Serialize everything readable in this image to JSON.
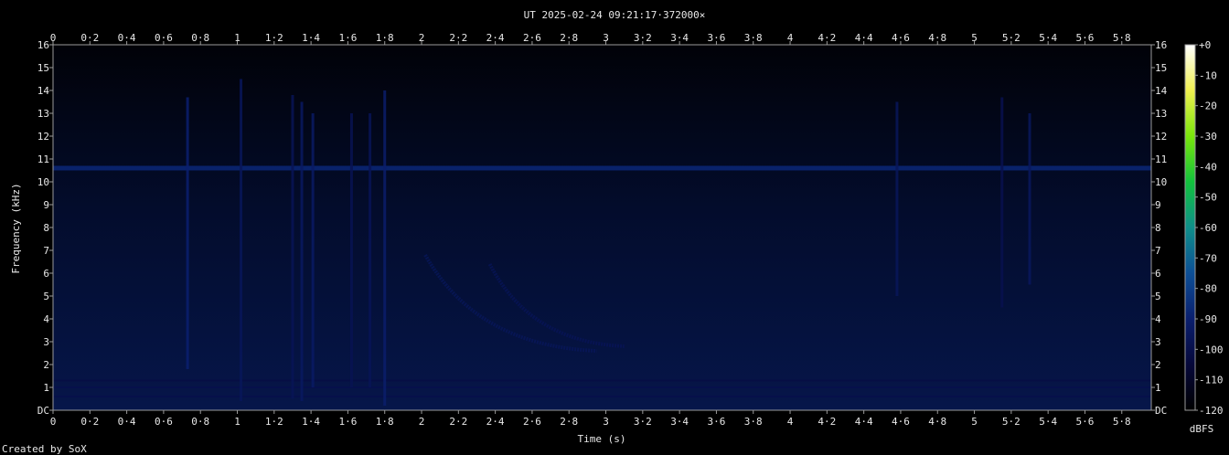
{
  "chart_data": {
    "type": "heatmap",
    "title": "UT 2025-02-24 09:21:17·372000×",
    "xlabel": "Time (s)",
    "ylabel": "Frequency (kHz)",
    "xlim": [
      0,
      5.96
    ],
    "ylim": [
      0,
      16
    ],
    "x_ticks": [
      "0",
      "0·2",
      "0·4",
      "0·6",
      "0·8",
      "1",
      "1·2",
      "1·4",
      "1·6",
      "1·8",
      "2",
      "2·2",
      "2·4",
      "2·6",
      "2·8",
      "3",
      "3·2",
      "3·4",
      "3·6",
      "3·8",
      "4",
      "4·2",
      "4·4",
      "4·6",
      "4·8",
      "5",
      "5·2",
      "5·4",
      "5·6",
      "5·8"
    ],
    "y_ticks": [
      "DC",
      "1",
      "2",
      "3",
      "4",
      "5",
      "6",
      "7",
      "8",
      "9",
      "10",
      "11",
      "12",
      "13",
      "14",
      "15",
      "16"
    ],
    "colorbar": {
      "label": "dBFS",
      "range": [
        -120,
        0
      ],
      "ticks": [
        "+0",
        "-10",
        "-20",
        "-30",
        "-40",
        "-50",
        "-60",
        "-70",
        "-80",
        "-90",
        "-100",
        "-110",
        "-120"
      ],
      "colors": [
        "#000000",
        "#06083a",
        "#0a1f6e",
        "#0d4f96",
        "#0f8f8a",
        "#12c23c",
        "#7ae60c",
        "#f0f050",
        "#ffffff"
      ]
    },
    "background_level_dbfs": -110,
    "features": [
      {
        "kind": "tone",
        "freq_khz": 10.6,
        "level_dbfs": -88
      },
      {
        "kind": "tone",
        "freq_khz": 1.3,
        "level_dbfs": -102
      },
      {
        "kind": "tone",
        "freq_khz": 1.0,
        "level_dbfs": -100
      },
      {
        "kind": "tone",
        "freq_khz": 0.6,
        "level_dbfs": -100
      },
      {
        "kind": "impulse",
        "t": 0.73,
        "f_low": 1.8,
        "f_high": 13.7,
        "level_dbfs": -90
      },
      {
        "kind": "impulse",
        "t": 1.02,
        "f_low": 0.4,
        "f_high": 14.5,
        "level_dbfs": -96
      },
      {
        "kind": "impulse",
        "t": 1.3,
        "f_low": 0.5,
        "f_high": 13.8,
        "level_dbfs": -97
      },
      {
        "kind": "impulse",
        "t": 1.35,
        "f_low": 0.4,
        "f_high": 13.5,
        "level_dbfs": -94
      },
      {
        "kind": "impulse",
        "t": 1.41,
        "f_low": 1.0,
        "f_high": 13.0,
        "level_dbfs": -93
      },
      {
        "kind": "impulse",
        "t": 1.62,
        "f_low": 1.0,
        "f_high": 13.0,
        "level_dbfs": -98
      },
      {
        "kind": "impulse",
        "t": 1.72,
        "f_low": 1.0,
        "f_high": 13.0,
        "level_dbfs": -97
      },
      {
        "kind": "impulse",
        "t": 1.8,
        "f_low": 0.2,
        "f_high": 14.0,
        "level_dbfs": -91
      },
      {
        "kind": "impulse",
        "t": 4.58,
        "f_low": 5.0,
        "f_high": 13.5,
        "level_dbfs": -96
      },
      {
        "kind": "impulse",
        "t": 5.15,
        "f_low": 4.5,
        "f_high": 13.7,
        "level_dbfs": -99
      },
      {
        "kind": "impulse",
        "t": 5.3,
        "f_low": 5.5,
        "f_high": 13.0,
        "level_dbfs": -95
      },
      {
        "kind": "sweep",
        "t_start": 2.02,
        "f_start": 6.8,
        "t_end": 2.95,
        "f_end": 2.6,
        "level_dbfs": -96
      },
      {
        "kind": "sweep",
        "t_start": 2.37,
        "f_start": 6.4,
        "t_end": 3.1,
        "f_end": 2.8,
        "level_dbfs": -97
      }
    ]
  },
  "footer": {
    "credit": "Created by SoX"
  }
}
